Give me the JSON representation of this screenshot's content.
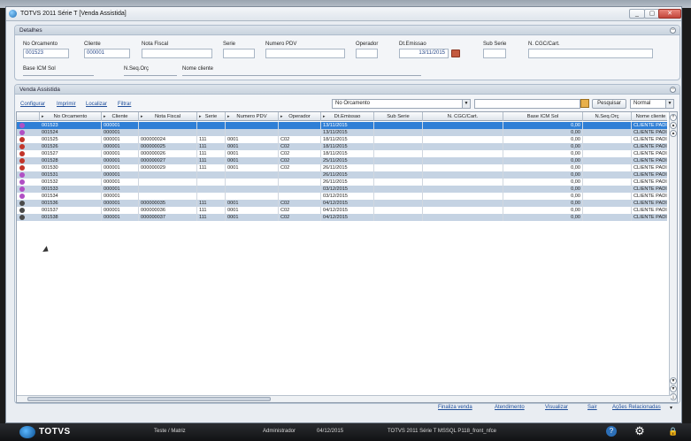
{
  "window": {
    "title": "TOTVS 2011 Série T  [Venda Assistida]",
    "controls": [
      "_",
      "▢",
      "✕"
    ]
  },
  "detalhes": {
    "title": "Detalhes",
    "fields": {
      "no_orcamento": {
        "label": "No Orcamento",
        "value": "001523"
      },
      "cliente": {
        "label": "Cliente",
        "value": "000001"
      },
      "nota_fiscal": {
        "label": "Nota Fiscal",
        "value": ""
      },
      "serie": {
        "label": "Serie",
        "value": ""
      },
      "numero_pdv": {
        "label": "Numero PDV",
        "value": ""
      },
      "operador": {
        "label": "Operador",
        "value": ""
      },
      "dt_emissao": {
        "label": "Dt.Emissao",
        "value": "13/11/2015"
      },
      "sub_serie": {
        "label": "Sub Serie",
        "value": ""
      },
      "cgc_cart": {
        "label": "N. CGC/Cart.",
        "value": ""
      },
      "base_icm_sol": {
        "label": "Base ICM Sol",
        "value": ""
      },
      "nseq_orc": {
        "label": "N.Seq.Orç",
        "value": ""
      },
      "nome_cliente": {
        "label": "Nome cliente",
        "value": ""
      }
    }
  },
  "venda": {
    "title": "Venda Assistida",
    "toolbar": {
      "configurar": "Configurar",
      "imprimir": "Imprimir",
      "localizar": "Localizar",
      "filtrar": "Filtrar"
    },
    "search": {
      "field_select": "No Orcamento",
      "query": "",
      "search_button": "Pesquisar",
      "mode_select": "Normal"
    },
    "columns": [
      "No Orcamento",
      "Cliente",
      "Nota Fiscal",
      "Serie",
      "Numero PDV",
      "Operador",
      "Dt.Emissao",
      "Sub Serie",
      "N. CGC/Cart.",
      "Base ICM Sol",
      "N.Seq.Orç",
      "Nome cliente"
    ],
    "rows": [
      {
        "status": "purple",
        "orc": "001523",
        "cli": "000001",
        "nf": "",
        "serie": "",
        "pdv": "",
        "op": "",
        "dt": "13/11/2015",
        "sub": "",
        "cgc": "",
        "base": "0,00",
        "seq": "",
        "nome": "CLIENTE PADI"
      },
      {
        "status": "purple",
        "orc": "001524",
        "cli": "000001",
        "nf": "",
        "serie": "",
        "pdv": "",
        "op": "",
        "dt": "13/11/2015",
        "sub": "",
        "cgc": "",
        "base": "0,00",
        "seq": "",
        "nome": "CLIENTE PADI"
      },
      {
        "status": "red",
        "orc": "001525",
        "cli": "000001",
        "nf": "000000024",
        "serie": "111",
        "pdv": "0001",
        "op": "C02",
        "dt": "18/11/2015",
        "sub": "",
        "cgc": "",
        "base": "0,00",
        "seq": "",
        "nome": "CLIENTE PADI"
      },
      {
        "status": "red",
        "orc": "001526",
        "cli": "000001",
        "nf": "000000025",
        "serie": "111",
        "pdv": "0001",
        "op": "C02",
        "dt": "18/11/2015",
        "sub": "",
        "cgc": "",
        "base": "0,00",
        "seq": "",
        "nome": "CLIENTE PADI"
      },
      {
        "status": "red",
        "orc": "001527",
        "cli": "000001",
        "nf": "000000026",
        "serie": "111",
        "pdv": "0001",
        "op": "C02",
        "dt": "18/11/2015",
        "sub": "",
        "cgc": "",
        "base": "0,00",
        "seq": "",
        "nome": "CLIENTE PADI"
      },
      {
        "status": "red",
        "orc": "001528",
        "cli": "000001",
        "nf": "000000027",
        "serie": "111",
        "pdv": "0001",
        "op": "C02",
        "dt": "25/11/2015",
        "sub": "",
        "cgc": "",
        "base": "0,00",
        "seq": "",
        "nome": "CLIENTE PADI"
      },
      {
        "status": "red",
        "orc": "001530",
        "cli": "000001",
        "nf": "000000029",
        "serie": "111",
        "pdv": "0001",
        "op": "C02",
        "dt": "26/11/2015",
        "sub": "",
        "cgc": "",
        "base": "0,00",
        "seq": "",
        "nome": "CLIENTE PADI"
      },
      {
        "status": "purple",
        "orc": "001531",
        "cli": "000001",
        "nf": "",
        "serie": "",
        "pdv": "",
        "op": "",
        "dt": "26/11/2015",
        "sub": "",
        "cgc": "",
        "base": "0,00",
        "seq": "",
        "nome": "CLIENTE PADI"
      },
      {
        "status": "purple",
        "orc": "001532",
        "cli": "000001",
        "nf": "",
        "serie": "",
        "pdv": "",
        "op": "",
        "dt": "26/11/2015",
        "sub": "",
        "cgc": "",
        "base": "0,00",
        "seq": "",
        "nome": "CLIENTE PADI"
      },
      {
        "status": "purple",
        "orc": "001533",
        "cli": "000001",
        "nf": "",
        "serie": "",
        "pdv": "",
        "op": "",
        "dt": "03/12/2015",
        "sub": "",
        "cgc": "",
        "base": "0,00",
        "seq": "",
        "nome": "CLIENTE PADI"
      },
      {
        "status": "purple",
        "orc": "001534",
        "cli": "000001",
        "nf": "",
        "serie": "",
        "pdv": "",
        "op": "",
        "dt": "03/12/2015",
        "sub": "",
        "cgc": "",
        "base": "0,00",
        "seq": "",
        "nome": "CLIENTE PADI"
      },
      {
        "status": "dark",
        "orc": "001536",
        "cli": "000001",
        "nf": "000000035",
        "serie": "111",
        "pdv": "0001",
        "op": "C02",
        "dt": "04/12/2015",
        "sub": "",
        "cgc": "",
        "base": "0,00",
        "seq": "",
        "nome": "CLIENTE PADI"
      },
      {
        "status": "dark",
        "orc": "001537",
        "cli": "000001",
        "nf": "000000036",
        "serie": "111",
        "pdv": "0001",
        "op": "C02",
        "dt": "04/12/2015",
        "sub": "",
        "cgc": "",
        "base": "0,00",
        "seq": "",
        "nome": "CLIENTE PADI"
      },
      {
        "status": "dark",
        "orc": "001538",
        "cli": "000001",
        "nf": "000000037",
        "serie": "111",
        "pdv": "0001",
        "op": "C02",
        "dt": "04/12/2015",
        "sub": "",
        "cgc": "",
        "base": "0,00",
        "seq": "",
        "nome": "CLIENTE PADI"
      }
    ],
    "selected_row": 0
  },
  "actions": {
    "finaliza": "Finaliza venda",
    "atendimento": "Atendimento",
    "visualizar": "Visualizar",
    "sair": "Sair",
    "acoes": "Ações Relacionadas"
  },
  "taskbar": {
    "brand": "TOTVS",
    "company": "Teste / Matriz",
    "user": "Administrador",
    "date": "04/12/2015",
    "env": "TOTVS 2011 Série T  MSSQL P118_front_nfce"
  },
  "colors": {
    "purple": "#b04fc4",
    "red": "#c2352a",
    "dark": "#4a4a4a",
    "selected": "#2f7fd6",
    "alt_row": "#c5d3e3"
  }
}
